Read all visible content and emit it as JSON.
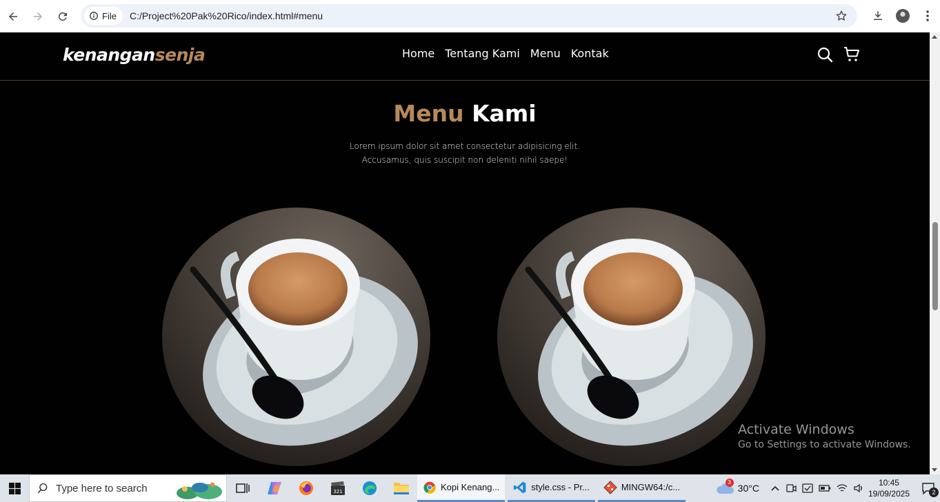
{
  "browser": {
    "chip_label": "File",
    "url": "C:/Project%20Pak%20Rico/index.html#menu"
  },
  "navbar": {
    "logo_main": "kenangan",
    "logo_accent": "senja",
    "links": [
      "Home",
      "Tentang Kami",
      "Menu",
      "Kontak"
    ]
  },
  "section": {
    "title_accent": "Menu",
    "title_rest": "Kami",
    "desc_line1": "Lorem ipsum dolor sit amet consectetur adipisicing elit.",
    "desc_line2": "Accusamus, quis suscipit non deleniti nihil saepe!"
  },
  "watermark": {
    "line1": "Activate Windows",
    "line2": "Go to Settings to activate Windows."
  },
  "taskbar": {
    "search_placeholder": "Type here to search",
    "apps": [
      "Kopi Kenang...",
      "style.css - Pr...",
      "MINGW64:/c..."
    ],
    "weather_temp": "30°C",
    "weather_badge": "3",
    "time": "10:45",
    "date": "19/09/2025",
    "notification_count": "2"
  },
  "colors": {
    "accent": "#b6895b",
    "page_bg": "#010101"
  }
}
